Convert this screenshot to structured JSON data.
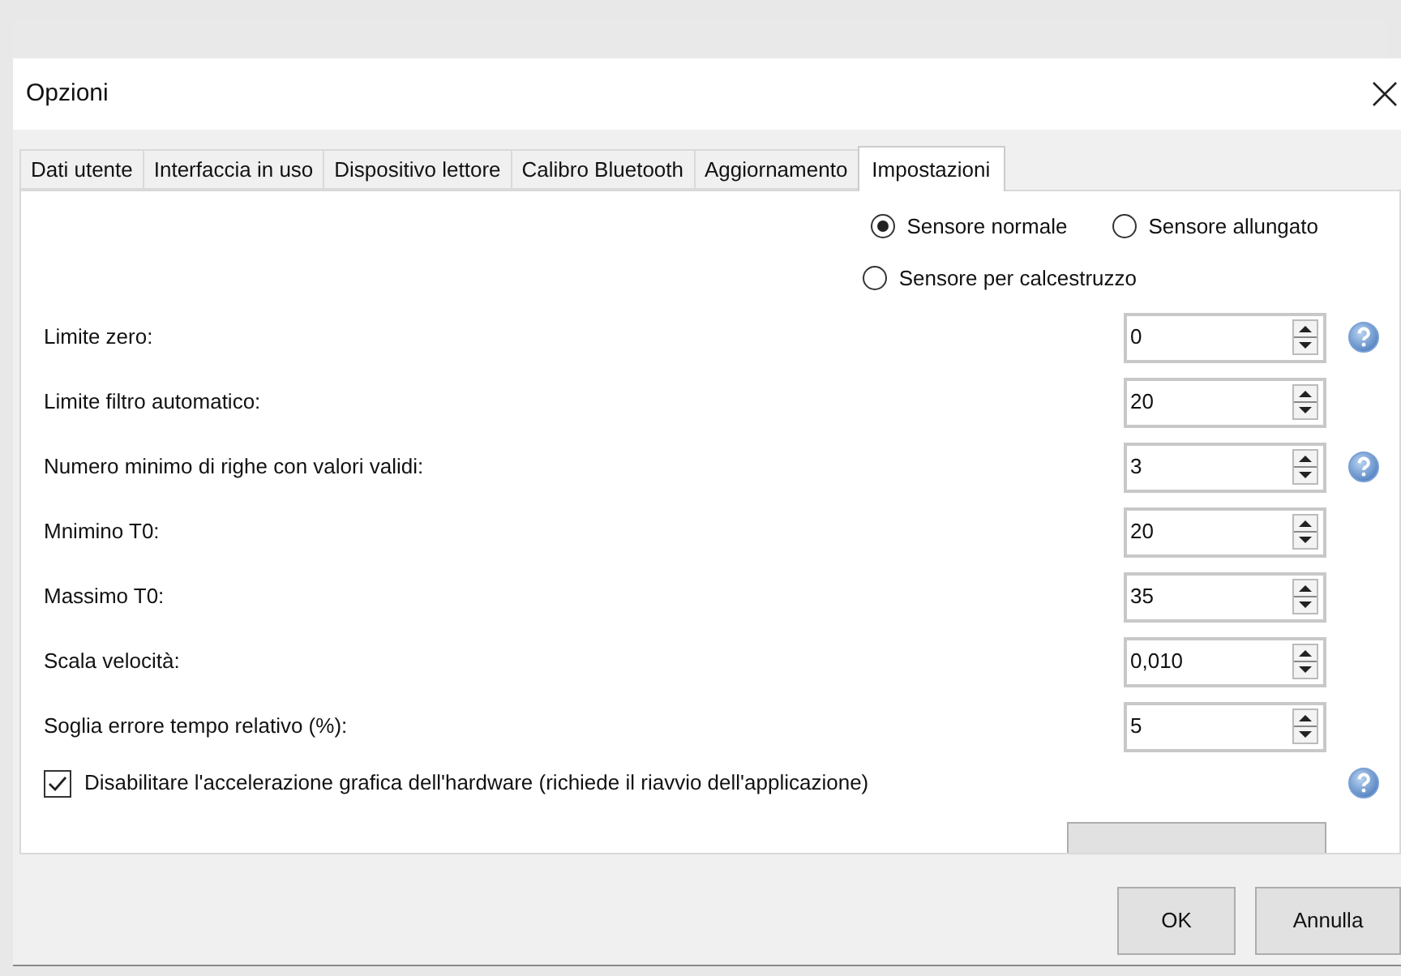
{
  "window": {
    "title": "Opzioni"
  },
  "tabs": [
    {
      "label": "Dati utente",
      "selected": false
    },
    {
      "label": "Interfaccia in uso",
      "selected": false
    },
    {
      "label": "Dispositivo lettore",
      "selected": false
    },
    {
      "label": "Calibro Bluetooth",
      "selected": false
    },
    {
      "label": "Aggiornamento",
      "selected": false
    },
    {
      "label": "Impostazioni",
      "selected": true
    }
  ],
  "sensor_options": [
    {
      "label": "Sensore normale",
      "selected": true
    },
    {
      "label": "Sensore allungato",
      "selected": false
    },
    {
      "label": "Sensore per calcestruzzo",
      "selected": false
    }
  ],
  "fields": [
    {
      "label": "Limite zero:",
      "value": "0",
      "help": true
    },
    {
      "label": "Limite filtro automatico:",
      "value": "20",
      "help": false
    },
    {
      "label": "Numero minimo di righe con valori validi:",
      "value": "3",
      "help": true
    },
    {
      "label": "Mnimino T0:",
      "value": "20",
      "help": false
    },
    {
      "label": "Massimo T0:",
      "value": "35",
      "help": false
    },
    {
      "label": "Scala velocità:",
      "value": "0,010",
      "help": false
    },
    {
      "label": "Soglia errore tempo relativo (%):",
      "value": "5",
      "help": false
    }
  ],
  "hardware_acceleration": {
    "label": "Disabilitare l'accelerazione grafica dell'hardware (richiede il riavvio dell'applicazione)",
    "checked": true,
    "help": true
  },
  "buttons": [
    "OK",
    "Annulla"
  ]
}
